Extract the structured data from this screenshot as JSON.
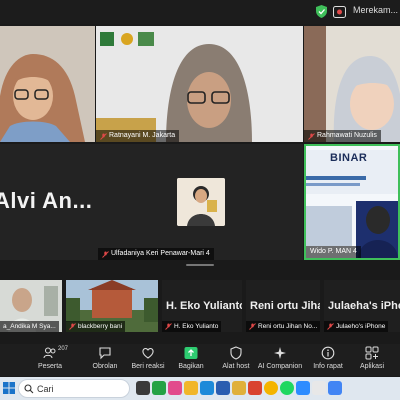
{
  "status": {
    "recording_label": "Merekam..."
  },
  "tiles": [
    {
      "name": "",
      "muted": false
    },
    {
      "name": "Ratnayani M. Jakarta",
      "muted": true
    },
    {
      "name": "Rahmawati Nuzulis",
      "muted": true
    },
    {
      "name": "Ulfadaniya Keri Penawar-Mari 4",
      "big_label": "Alvi An...",
      "muted": true
    },
    {
      "name": "Wido P. MAN 4",
      "banner": "BINAR",
      "muted": false
    }
  ],
  "filmstrip": [
    {
      "name": "a_Andika M Sya...",
      "title": ""
    },
    {
      "name": "blackberry bani",
      "title": ""
    },
    {
      "name": "H. Eko Yulianto",
      "title": "H. Eko Yulianto"
    },
    {
      "name": "Reni ortu Jihan No...",
      "title": "Reni ortu Jihan..."
    },
    {
      "name": "Julaeho's iPhone",
      "title": "Julaeha's iPhone"
    }
  ],
  "toolbar": {
    "participants_count": "207",
    "items": [
      {
        "label": "Peserta",
        "icon": "participants-icon"
      },
      {
        "label": "Obrolan",
        "icon": "chat-icon"
      },
      {
        "label": "Beri reaksi",
        "icon": "heart-icon"
      },
      {
        "label": "Bagikan",
        "icon": "share-icon"
      },
      {
        "label": "Alat host",
        "icon": "shield-icon"
      },
      {
        "label": "AI Companion",
        "icon": "sparkle-icon"
      },
      {
        "label": "Info rapat",
        "icon": "info-icon"
      },
      {
        "label": "Aplikasi",
        "icon": "apps-icon"
      }
    ]
  },
  "taskbar": {
    "search_label": "Cari"
  },
  "colors": {
    "active_speaker": "#3fbf5a",
    "share_green": "#2ecc71",
    "muted_red": "#e04848"
  }
}
